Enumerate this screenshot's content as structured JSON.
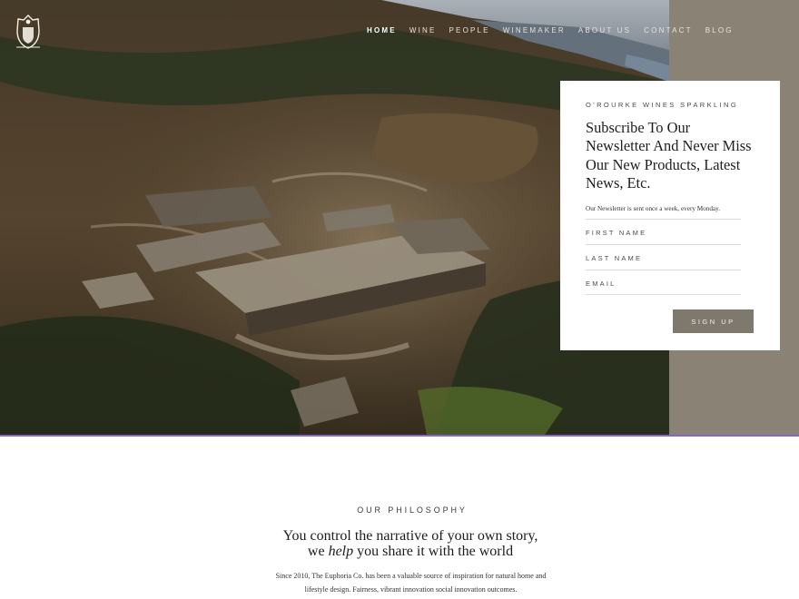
{
  "nav": {
    "items": [
      {
        "label": "HOME",
        "active": true
      },
      {
        "label": "WINE",
        "active": false
      },
      {
        "label": "PEOPLE",
        "active": false
      },
      {
        "label": "WINEMAKER",
        "active": false
      },
      {
        "label": "ABOUT US",
        "active": false
      },
      {
        "label": "CONTACT",
        "active": false
      },
      {
        "label": "BLOG",
        "active": false
      }
    ]
  },
  "newsletter": {
    "eyebrow": "O'ROURKE WINES SPARKLING",
    "title": "Subscribe To Our Newsletter And Never Miss Our New Products, Latest News, Etc.",
    "note": "Our Newsletter is sent once a week, every Monday.",
    "fields": {
      "first_name": "FIRST NAME",
      "last_name": "LAST NAME",
      "email": "EMAIL"
    },
    "button": "SIGN UP"
  },
  "philosophy": {
    "eyebrow": "OUR PHILOSOPHY",
    "heading_line1": "You control the narrative of your own story,",
    "heading_line2_pre": "we",
    "heading_line2_em": "help",
    "heading_line2_post": "you share it with the world",
    "body": "Since 2010, The Euphoria Co. has been a valuable source of inspiration for natural home and lifestyle design. Fairness, vibrant innovation social innovation outcomes."
  },
  "colors": {
    "side_panel": "#8a8274",
    "button": "#7f786c",
    "accent_line": "#8a63d2"
  }
}
